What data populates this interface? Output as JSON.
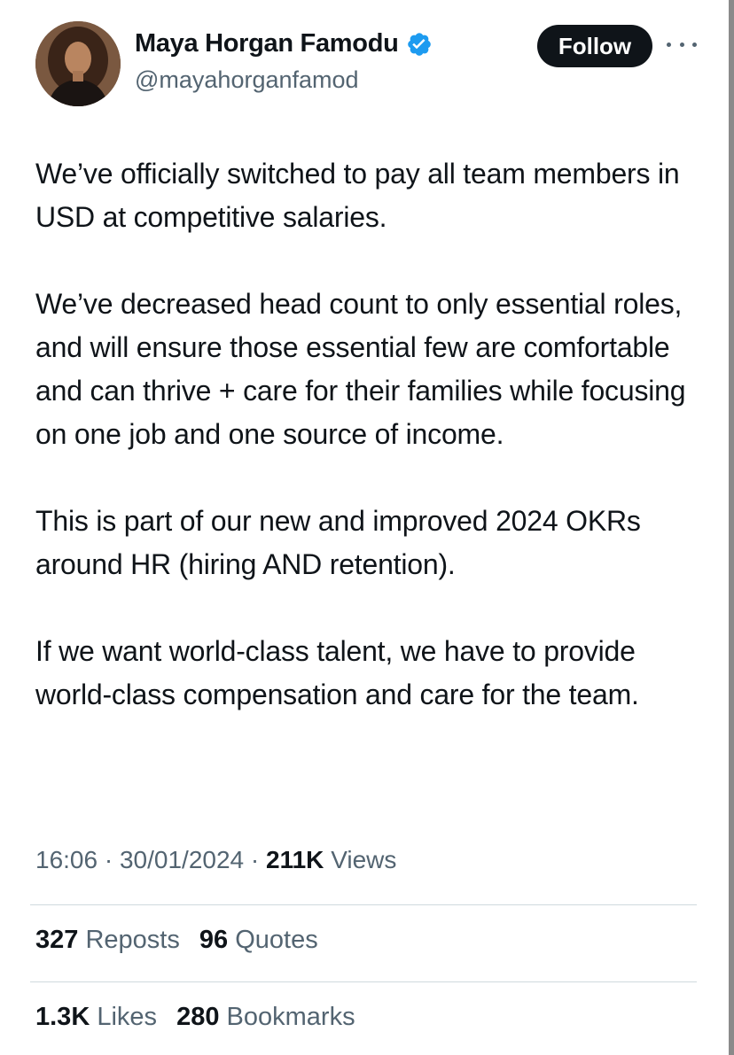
{
  "author": {
    "display_name": "Maya Horgan Famodu",
    "handle": "@mayahorganfamod",
    "verified_icon": "verified-badge-icon",
    "verified_color": "#1d9bf0"
  },
  "actions": {
    "follow_label": "Follow",
    "more_icon": "more-horizontal-icon"
  },
  "tweet": {
    "paragraphs": [
      "We’ve officially switched to pay all team members in USD at competitive salaries.",
      "We’ve decreased head count to only essential roles, and will ensure those essential few are comfortable and can thrive + care for their families while focusing on one job and one source of income.",
      "This is part of our new and improved 2024 OKRs around HR (hiring AND retention).",
      "If we want world-class talent, we have to provide world-class compensation and care for the team."
    ]
  },
  "meta": {
    "time": "16:06",
    "separator": "·",
    "date": "30/01/2024",
    "views_count": "211K",
    "views_label": "Views"
  },
  "stats": {
    "reposts_count": "327",
    "reposts_label": "Reposts",
    "quotes_count": "96",
    "quotes_label": "Quotes",
    "likes_count": "1.3K",
    "likes_label": "Likes",
    "bookmarks_count": "280",
    "bookmarks_label": "Bookmarks"
  }
}
